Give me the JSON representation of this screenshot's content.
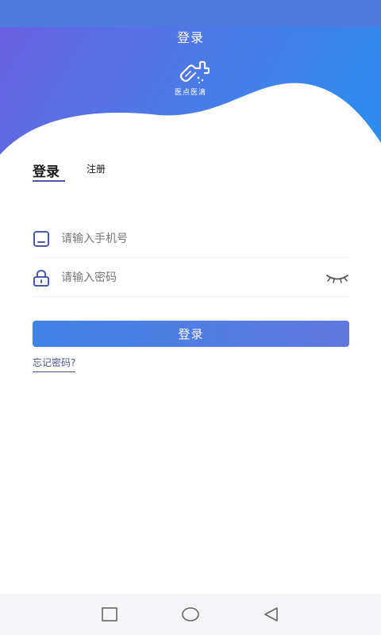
{
  "header": {
    "title": "登录",
    "logo_text": "医点医滴",
    "colors": {
      "gradient_start": "#6a5fe0",
      "gradient_end": "#2a8ff0"
    }
  },
  "tabs": [
    {
      "label": "登录",
      "active": true
    },
    {
      "label": "注册",
      "active": false
    }
  ],
  "form": {
    "phone": {
      "placeholder": "请输入手机号",
      "value": "",
      "icon": "tablet-icon"
    },
    "password": {
      "placeholder": "请输入密码",
      "value": "",
      "icon": "lock-icon",
      "toggle_icon": "eye-closed-icon"
    }
  },
  "actions": {
    "login_label": "登录",
    "forgot_label": "忘记密码?"
  },
  "nav": {
    "icons": [
      "square-recent-icon",
      "circle-home-icon",
      "triangle-back-icon"
    ]
  }
}
